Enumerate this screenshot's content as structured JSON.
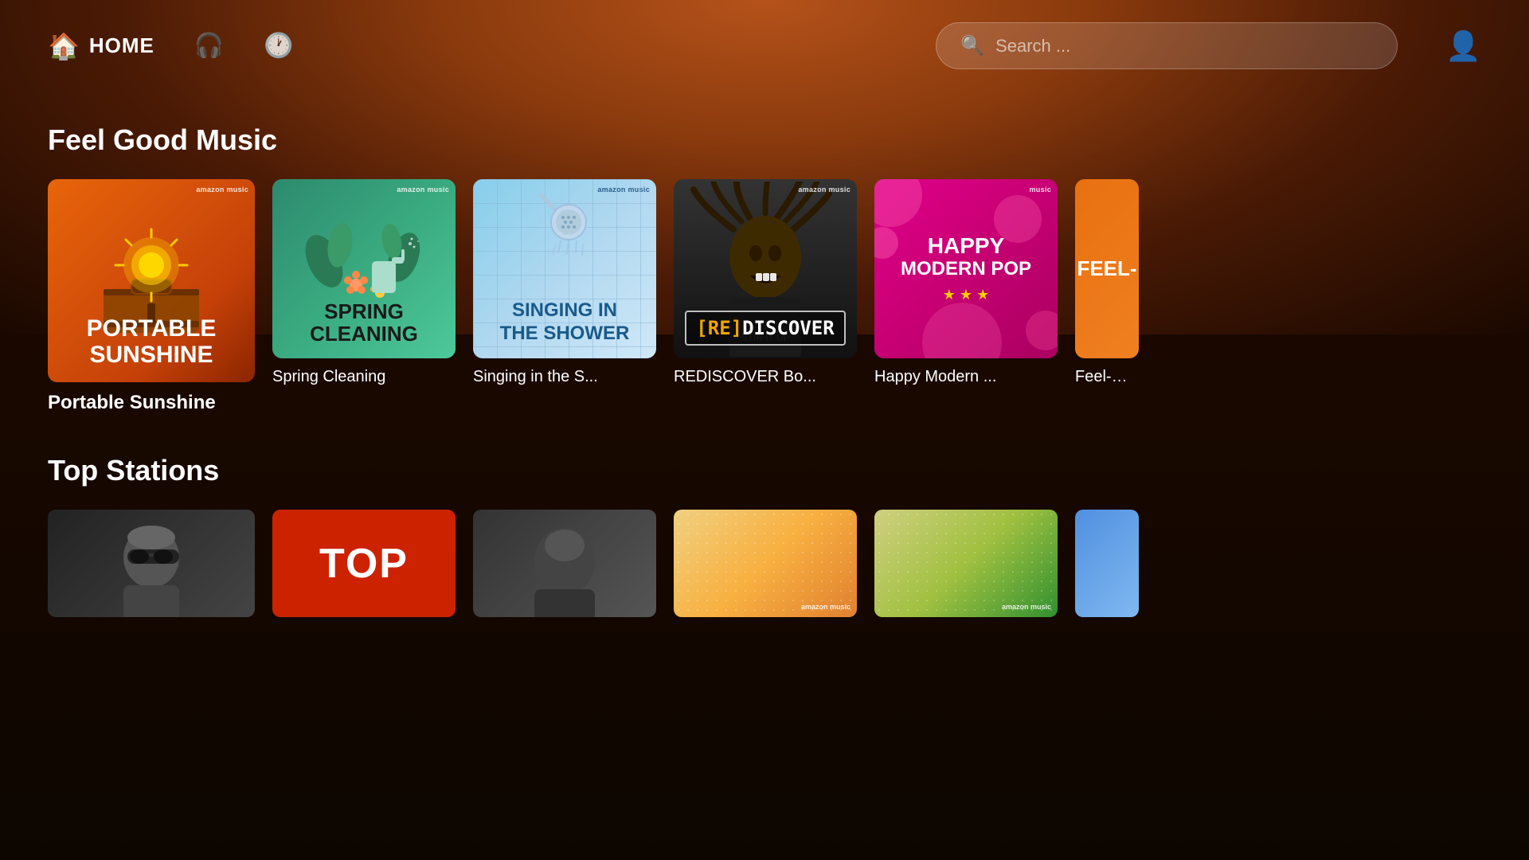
{
  "header": {
    "home_label": "HOME",
    "search_placeholder": "Search ...",
    "nav": {
      "home_icon": "🏠",
      "headphones_icon": "🎧",
      "history_icon": "🕐",
      "profile_icon": "👤"
    }
  },
  "feel_good_section": {
    "title": "Feel Good Music",
    "cards": [
      {
        "id": "portable-sunshine",
        "title": "Portable Sunshine",
        "label_display": "Portable Sunshine",
        "badge": "amazon music"
      },
      {
        "id": "spring-cleaning",
        "title": "Spring Cleaning",
        "label_display": "Spring Cleaning",
        "badge": "amazon music"
      },
      {
        "id": "singing-shower",
        "title": "Singing in the S...",
        "label_display": "Singing in the S...",
        "badge": "amazon music"
      },
      {
        "id": "rediscover",
        "title": "REDISCOVER Bo...",
        "label_display": "REDISCOVER Bo...",
        "badge": "amazon music"
      },
      {
        "id": "happy-modern",
        "title": "Happy Modern ...",
        "label_display": "Happy Modern ...",
        "badge": "music"
      },
      {
        "id": "feel-good-partial",
        "title": "Feel-Go...",
        "label_display": "Feel-Go...",
        "badge": ""
      }
    ],
    "card_texts": {
      "portable_line1": "PORTABLE",
      "portable_line2": "SUNSHINE",
      "spring_line1": "SPRING",
      "spring_line2": "CLEANING",
      "singing_line1": "SINGING IN",
      "singing_line2": "THE SHOWER",
      "rediscover": "[RE]DISCOVER",
      "happy_line1": "HAPPY",
      "happy_line2": "MODERN POP",
      "stars": "★ ★ ★",
      "feel_partial": "FEEL-"
    }
  },
  "top_stations_section": {
    "title": "Top Stations",
    "cards": [
      {
        "id": "station-person1",
        "title": ""
      },
      {
        "id": "station-top",
        "title": "",
        "top_text": "ToP"
      },
      {
        "id": "station-person2",
        "title": ""
      },
      {
        "id": "station-gradient1",
        "badge": "amazon music"
      },
      {
        "id": "station-gradient2",
        "badge": "amazon music"
      },
      {
        "id": "station-blue",
        "title": ""
      }
    ]
  }
}
